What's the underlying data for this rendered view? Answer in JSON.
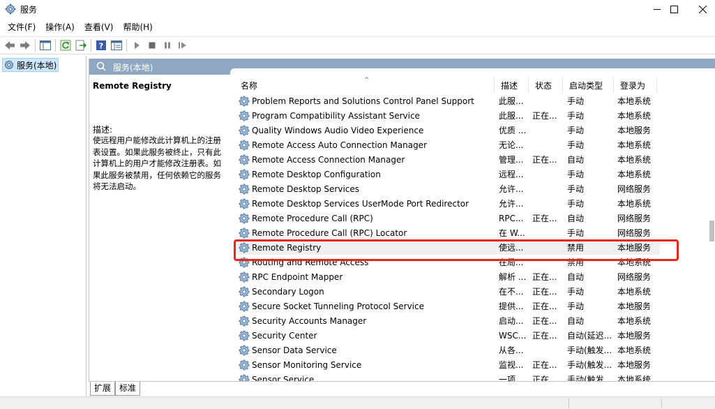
{
  "window": {
    "title": "服务"
  },
  "menu": [
    "文件(F)",
    "操作(A)",
    "查看(V)",
    "帮助(H)"
  ],
  "tree": {
    "root_label": "服务(本地)"
  },
  "panel": {
    "header": "服务(本地)",
    "selected_name": "Remote Registry",
    "desc_label": "描述:",
    "desc_text": "使远程用户能修改此计算机上的注册表设置。如果此服务被终止，只有此计算机上的用户才能修改注册表。如果此服务被禁用，任何依赖它的服务将无法启动。"
  },
  "columns": [
    "名称",
    "描述",
    "状态",
    "启动类型",
    "登录为"
  ],
  "services": [
    {
      "name": "Problem Reports and Solutions Control Panel Support",
      "desc": "此服...",
      "status": "",
      "startup": "手动",
      "logon": "本地系统"
    },
    {
      "name": "Program Compatibility Assistant Service",
      "desc": "此服...",
      "status": "正在...",
      "startup": "手动",
      "logon": "本地系统"
    },
    {
      "name": "Quality Windows Audio Video Experience",
      "desc": "优质 ...",
      "status": "",
      "startup": "手动",
      "logon": "本地服务"
    },
    {
      "name": "Remote Access Auto Connection Manager",
      "desc": "无论...",
      "status": "",
      "startup": "手动",
      "logon": "本地系统"
    },
    {
      "name": "Remote Access Connection Manager",
      "desc": "管理...",
      "status": "正在...",
      "startup": "自动",
      "logon": "本地系统"
    },
    {
      "name": "Remote Desktop Configuration",
      "desc": "远程...",
      "status": "",
      "startup": "手动",
      "logon": "本地系统"
    },
    {
      "name": "Remote Desktop Services",
      "desc": "允许...",
      "status": "",
      "startup": "手动",
      "logon": "网络服务"
    },
    {
      "name": "Remote Desktop Services UserMode Port Redirector",
      "desc": "允许...",
      "status": "",
      "startup": "手动",
      "logon": "本地系统"
    },
    {
      "name": "Remote Procedure Call (RPC)",
      "desc": "RPC...",
      "status": "正在...",
      "startup": "自动",
      "logon": "网络服务"
    },
    {
      "name": "Remote Procedure Call (RPC) Locator",
      "desc": "在 W...",
      "status": "",
      "startup": "手动",
      "logon": "网络服务"
    },
    {
      "name": "Remote Registry",
      "desc": "使远...",
      "status": "",
      "startup": "禁用",
      "logon": "本地服务"
    },
    {
      "name": "Routing and Remote Access",
      "desc": "在局...",
      "status": "",
      "startup": "禁用",
      "logon": "本地系统"
    },
    {
      "name": "RPC Endpoint Mapper",
      "desc": "解析 ...",
      "status": "正在...",
      "startup": "自动",
      "logon": "网络服务"
    },
    {
      "name": "Secondary Logon",
      "desc": "在不...",
      "status": "正在...",
      "startup": "手动",
      "logon": "本地系统"
    },
    {
      "name": "Secure Socket Tunneling Protocol Service",
      "desc": "提供...",
      "status": "正在...",
      "startup": "手动",
      "logon": "本地服务"
    },
    {
      "name": "Security Accounts Manager",
      "desc": "启动...",
      "status": "正在...",
      "startup": "自动",
      "logon": "本地系统"
    },
    {
      "name": "Security Center",
      "desc": "WSC...",
      "status": "正在...",
      "startup": "自动(延迟...",
      "logon": "本地服务"
    },
    {
      "name": "Sensor Data Service",
      "desc": "从各...",
      "status": "",
      "startup": "手动(触发...",
      "logon": "本地系统"
    },
    {
      "name": "Sensor Monitoring Service",
      "desc": "监视...",
      "status": "正在...",
      "startup": "手动(触发...",
      "logon": "本地服务"
    },
    {
      "name": "Sensor Service",
      "desc": "一项...",
      "status": "正在...",
      "startup": "手动(触发...",
      "logon": "本地系统"
    }
  ],
  "tabs": [
    "扩展",
    "标准"
  ],
  "colors": {
    "header_bg": "#8fa7c1",
    "highlight": "#e8261c",
    "selection": "#cce8ff"
  }
}
